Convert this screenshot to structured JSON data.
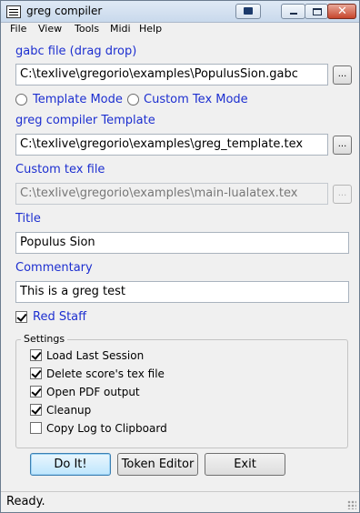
{
  "window": {
    "title": "greg compiler",
    "min_icon": "minimize-icon",
    "max_icon": "maximize-icon",
    "close_icon": "close-icon",
    "close_glyph": "✕"
  },
  "menu": [
    "File",
    "View",
    "Tools",
    "Midi",
    "Help"
  ],
  "gabc": {
    "label": "gabc file (drag  drop)",
    "value": "C:\\texlive\\gregorio\\examples\\PopulusSion.gabc",
    "browse": "..."
  },
  "mode": {
    "template_label": "Template Mode",
    "custom_label": "Custom Tex Mode"
  },
  "template": {
    "label": "greg compiler Template",
    "value": "C:\\texlive\\gregorio\\examples\\greg_template.tex",
    "browse": "..."
  },
  "customtex": {
    "label": "Custom tex file",
    "value": "C:\\texlive\\gregorio\\examples\\main-lualatex.tex",
    "browse": "..."
  },
  "title": {
    "label": "Title",
    "value": "Populus Sion"
  },
  "commentary": {
    "label": "Commentary",
    "value": "This is a greg test"
  },
  "redstaff": {
    "label": "Red Staff",
    "checked": true
  },
  "settings": {
    "title": "Settings",
    "options": [
      {
        "label": "Load Last Session",
        "checked": true
      },
      {
        "label": "Delete score's tex file",
        "checked": true
      },
      {
        "label": "Open PDF output",
        "checked": true
      },
      {
        "label": "Cleanup",
        "checked": true
      },
      {
        "label": "Copy Log to Clipboard",
        "checked": false
      }
    ]
  },
  "buttons": {
    "doit": "Do It!",
    "token_editor": "Token Editor",
    "exit": "Exit"
  },
  "status": {
    "text": "Ready."
  },
  "colors": {
    "label_blue": "#1d2fd0",
    "close_red": "#c7452c"
  }
}
